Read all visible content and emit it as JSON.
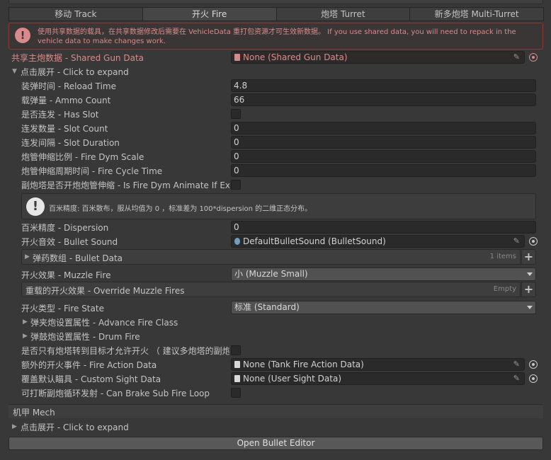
{
  "tabs": [
    "移动 Track",
    "开火 Fire",
    "炮塔 Turret",
    "新多炮塔 Multi-Turret"
  ],
  "warning": "使用共享数据的载具，在共享数据修改后需要在 VehicleData 重打包资源才可生效新数据。 If you use shared data, you will need to repack in the vehicle data to make changes work.",
  "shared_gun": {
    "label": "共享主炮数据 - Shared Gun Data",
    "value": "None (Shared Gun Data)"
  },
  "expand_label": "点击展开 - Click to expand",
  "fields": {
    "reload": {
      "label": "装弹时间 - Reload Time",
      "value": "4.8"
    },
    "ammo": {
      "label": "载弹量 - Ammo Count",
      "value": "66"
    },
    "has_slot": {
      "label": "是否连发 - Has Slot"
    },
    "slot_count": {
      "label": "连发数量 - Slot Count",
      "value": "0"
    },
    "slot_duration": {
      "label": "连发间隔 - Slot Duration",
      "value": "0"
    },
    "dym_scale": {
      "label": "炮管伸缩比例 - Fire Dym Scale",
      "value": "0"
    },
    "cycle_time": {
      "label": "炮管伸缩周期时间 - Fire Cycle Time",
      "value": "0"
    },
    "dym_animate": {
      "label": "副炮塔是否开炮炮管伸缩 - Is Fire Dym Animate If Extra"
    }
  },
  "info": "百米精度: 百米散布，服从均值为 0 ，标准差为 100*dispersion 的二维正态分布。",
  "dispersion": {
    "label": "百米精度 - Dispersion",
    "value": "0"
  },
  "bullet_sound": {
    "label": "开火音效 - Bullet Sound",
    "value": "DefaultBulletSound (BulletSound)"
  },
  "bullet_data": {
    "label": "弹药数组 - Bullet Data",
    "count": "1 items"
  },
  "muzzle_fire": {
    "label": "开火效果 - Muzzle Fire",
    "value": "小 (Muzzle Small)"
  },
  "override_muzzle": {
    "label": "重载的开火效果 - Override Muzzle Fires",
    "count": "Empty"
  },
  "fire_state": {
    "label": "开火类型 - Fire State",
    "value": "标准 (Standard)"
  },
  "advance_fire": "弹夹炮设置属性 - Advance Fire Class",
  "drum_fire": "弹鼓炮设置属性 - Drum Fire",
  "only_turret": {
    "label": "是否只有炮塔转到目标才允许开火 （ 建议多炮塔的副炮使用）"
  },
  "fire_action": {
    "label": "额外的开火事件 - Fire Action Data",
    "value": "None (Tank Fire Action Data)"
  },
  "custom_sight": {
    "label": "覆盖默认瞄具 - Custom Sight Data",
    "value": "None (User Sight Data)"
  },
  "can_brake": {
    "label": "可打断副炮循环发射 - Can Brake Sub Fire Loop"
  },
  "mech": {
    "title": "机甲 Mech",
    "expand": "点击展开 - Click to expand"
  },
  "open_bullet_editor": "Open Bullet Editor",
  "colors": {
    "warning_red": "#d98a8a",
    "bg": "#383838",
    "field": "#2a2a2a"
  }
}
